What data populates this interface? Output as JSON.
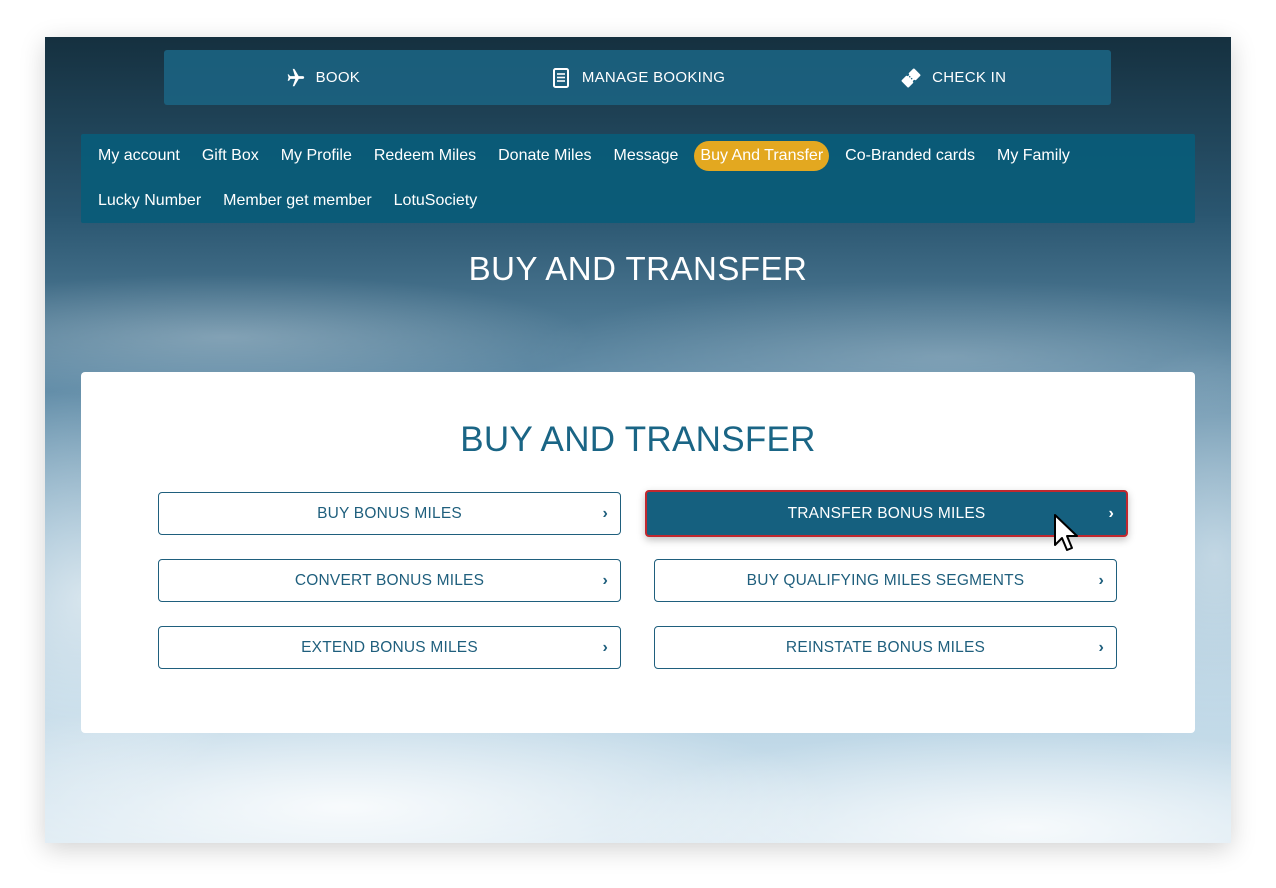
{
  "topnav": {
    "items": [
      {
        "label": "BOOK",
        "icon": "plane-icon"
      },
      {
        "label": "MANAGE BOOKING",
        "icon": "booklet-icon"
      },
      {
        "label": "CHECK IN",
        "icon": "ticket-icon"
      }
    ]
  },
  "subnav": {
    "items": [
      {
        "label": "My account"
      },
      {
        "label": "Gift Box"
      },
      {
        "label": "My Profile"
      },
      {
        "label": "Redeem Miles"
      },
      {
        "label": "Donate Miles"
      },
      {
        "label": "Message"
      },
      {
        "label": "Buy And Transfer",
        "active": true
      },
      {
        "label": "Co-Branded cards"
      },
      {
        "label": "My Family"
      },
      {
        "label": "Lucky Number"
      },
      {
        "label": "Member get member"
      },
      {
        "label": "LotuSociety"
      }
    ],
    "active_color": "#e3a820"
  },
  "hero": {
    "title": "BUY AND TRANSFER"
  },
  "panel": {
    "title": "BUY AND TRANSFER",
    "options": [
      {
        "label": "BUY BONUS MILES",
        "chevron": "›"
      },
      {
        "label": "TRANSFER BONUS MILES",
        "chevron": "›",
        "selected": true
      },
      {
        "label": "CONVERT BONUS MILES",
        "chevron": "›"
      },
      {
        "label": "BUY QUALIFYING MILES SEGMENTS",
        "chevron": "›"
      },
      {
        "label": "EXTEND BONUS MILES",
        "chevron": "›"
      },
      {
        "label": "REINSTATE BONUS MILES",
        "chevron": "›"
      }
    ]
  },
  "colors": {
    "brand": "#1a6585",
    "nav_bg": "#0a5c78",
    "selected_bg": "#15607f",
    "selected_border": "#c0282f"
  }
}
